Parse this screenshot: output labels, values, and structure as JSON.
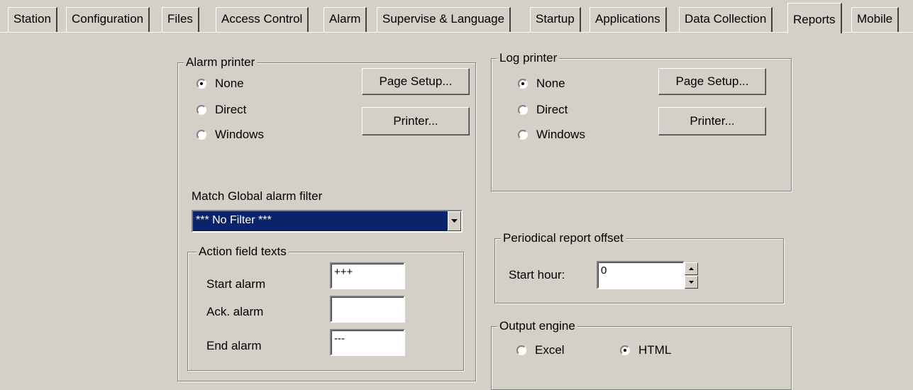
{
  "tabs": [
    {
      "label": "Station"
    },
    {
      "label": "Configuration"
    },
    {
      "label": "Files"
    },
    {
      "label": "Access Control"
    },
    {
      "label": "Alarm"
    },
    {
      "label": "Supervise & Language"
    },
    {
      "label": "Startup"
    },
    {
      "label": "Applications"
    },
    {
      "label": "Data Collection"
    },
    {
      "label": "Reports",
      "active": true
    },
    {
      "label": "Mobile"
    }
  ],
  "alarm_printer": {
    "title": "Alarm printer",
    "options": [
      "None",
      "Direct",
      "Windows"
    ],
    "selected": "None",
    "page_setup_label": "Page Setup...",
    "printer_label": "Printer...",
    "filter_label": "Match Global alarm filter",
    "filter_value": "*** No Filter ***"
  },
  "action_field_texts": {
    "title": "Action field texts",
    "start_label": "Start alarm",
    "start_value": "+++",
    "ack_label": "Ack. alarm",
    "ack_value": "",
    "end_label": "End alarm",
    "end_value": "---"
  },
  "log_printer": {
    "title": "Log printer",
    "options": [
      "None",
      "Direct",
      "Windows"
    ],
    "selected": "None",
    "page_setup_label": "Page Setup...",
    "printer_label": "Printer..."
  },
  "periodical": {
    "title": "Periodical report offset",
    "start_hour_label": "Start hour:",
    "start_hour_value": "0"
  },
  "output_engine": {
    "title": "Output engine",
    "options": [
      "Excel",
      "HTML"
    ],
    "selected": "HTML"
  }
}
